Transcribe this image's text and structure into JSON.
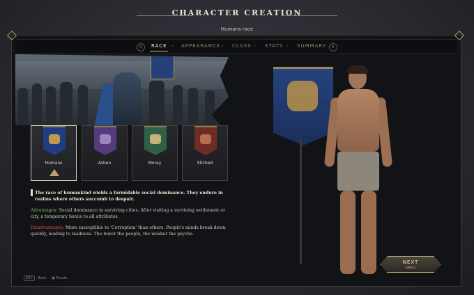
{
  "header": {
    "title": "CHARACTER CREATION",
    "subtitle": "Humans race"
  },
  "tabs": [
    {
      "label": "RACE",
      "active": true
    },
    {
      "label": "APPEARANCE",
      "active": false
    },
    {
      "label": "CLASS",
      "active": false
    },
    {
      "label": "STATS",
      "active": false
    },
    {
      "label": "SUMMARY",
      "active": false
    }
  ],
  "tab_keys": {
    "prev": "Q",
    "next": "E"
  },
  "races": [
    {
      "name": "Humans",
      "selected": true,
      "color": "#1f3d80",
      "emblem": "#c19a52"
    },
    {
      "name": "Ashen",
      "selected": false,
      "color": "#553a7c",
      "emblem": "#9c87bd"
    },
    {
      "name": "Moray",
      "selected": false,
      "color": "#2f6046",
      "emblem": "#c6b27a"
    },
    {
      "name": "Stiched",
      "selected": false,
      "color": "#6e2d24",
      "emblem": "#b76c53"
    }
  ],
  "description": {
    "intro": "The race of humankind wields a formidable social dominance. They endure in realms where others succumb to despair.",
    "advantages_label": "Advantages:",
    "advantages_text": "Social dominance in surviving cities. After visiting a surviving settlement or city, a temporary bonus to all attributes.",
    "disadvantages_label": "Disadvantages:",
    "disadvantages_text": "More susceptible to 'Corruption' than others. People's minds break down quickly, leading to madness. The fewer the people, the weaker the psyche."
  },
  "hints": {
    "back_key": "ESC",
    "back_label": "Back",
    "rotate_label": "Rotate"
  },
  "next_button": {
    "label": "NEXT",
    "sub": "SPACE"
  }
}
